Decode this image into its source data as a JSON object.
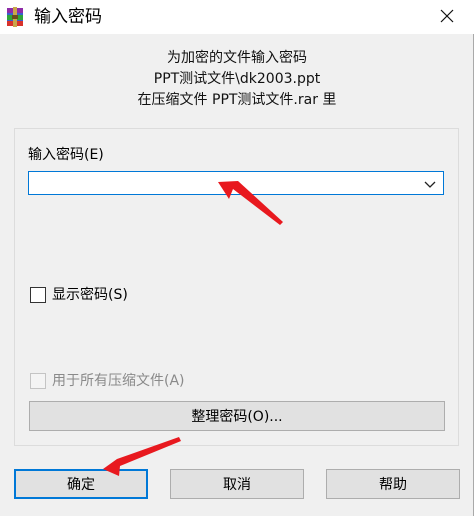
{
  "window": {
    "title": "输入密码",
    "app_icon": "winrar-icon",
    "close_icon": "close-icon"
  },
  "info": {
    "line1": "为加密的文件输入密码",
    "line2": "PPT测试文件\\dk2003.ppt",
    "line3": "在压缩文件 PPT测试文件.rar 里"
  },
  "password": {
    "label": "输入密码(E)",
    "value": "",
    "dropdown_icon": "chevron-down-icon"
  },
  "show_password": {
    "label": "显示密码(S)",
    "checked": false
  },
  "use_for_all": {
    "label": "用于所有压缩文件(A)",
    "checked": false,
    "disabled": true
  },
  "organize_button": {
    "label": "整理密码(O)..."
  },
  "buttons": {
    "ok": "确定",
    "cancel": "取消",
    "help": "帮助"
  },
  "annotations": {
    "arrow_color": "#e8191f"
  },
  "colors": {
    "focus": "#0078d7",
    "button_bg": "#e1e1e1",
    "dialog_bg": "#f0f0f0"
  }
}
